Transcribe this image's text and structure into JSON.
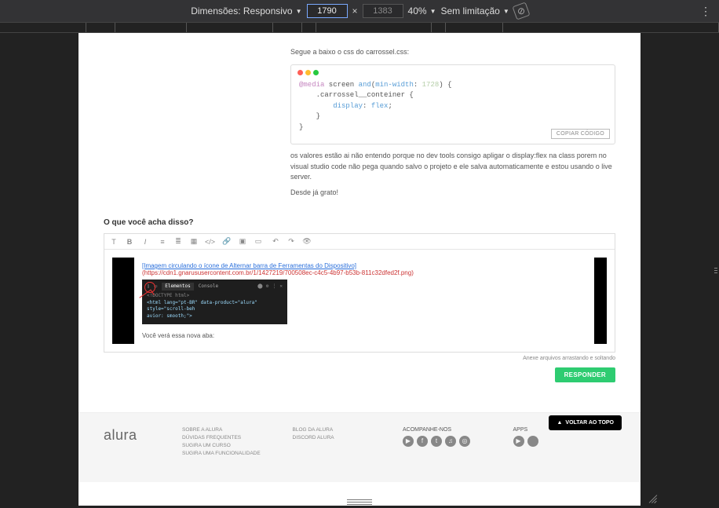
{
  "toolbar": {
    "dimensions_label": "Dimensões: Responsivo",
    "width": "1790",
    "height": "1383",
    "zoom": "40%",
    "throttling": "Sem limitação"
  },
  "post": {
    "intro": "Segue a baixo o css do carrossel.css:",
    "code": "@media screen and(min-width: 1728) {\n    .carrossel__conteiner {\n        display: flex;\n    }\n}",
    "copy_label": "COPIAR CÓDIGO",
    "body": "os valores estão ai não entendo porque no dev tools consigo apligar o display:flex na class porem no visual studio code não pega quando salvo o projeto e ele salva automaticamente e estou usando o live server.",
    "thanks": "Desde já grato!"
  },
  "reply": {
    "heading": "O que você acha disso?",
    "link_text": "[Imagem circulando o ícone de Alternar barra de Ferramentas do Dispositivo]",
    "link_url": "(https://cdn1.gnarususercontent.com.br/1/1427219/700508ec-c4c5-4b97-b53b-811c32dfed2f.png)",
    "doctype": "<!DOCTYPE html>",
    "html_line": "<html lang=\"pt-BR\" data-product=\"alura\" style=\"scroll-beh",
    "avior": "avior: smooth;\">",
    "tab_elem": "Elementos",
    "tab_cons": "Console",
    "note": "Você verá essa nova aba:",
    "attach_hint": "Anexe arquivos arrastando e soltando",
    "button": "RESPONDER"
  },
  "backtop": "VOLTAR AO TOPO",
  "footer": {
    "logo": "alura",
    "col1": {
      "l1": "SOBRE A ALURA",
      "l2": "DÚVIDAS FREQUENTES",
      "l3": "SUGIRA UM CURSO",
      "l4": "SUGIRA UMA FUNCIONALIDADE"
    },
    "col2": {
      "l1": "BLOG DA ALURA",
      "l2": "DISCORD ALURA"
    },
    "col3": {
      "h": "ACOMPANHE-NOS"
    },
    "col4": {
      "h": "APPS"
    }
  }
}
